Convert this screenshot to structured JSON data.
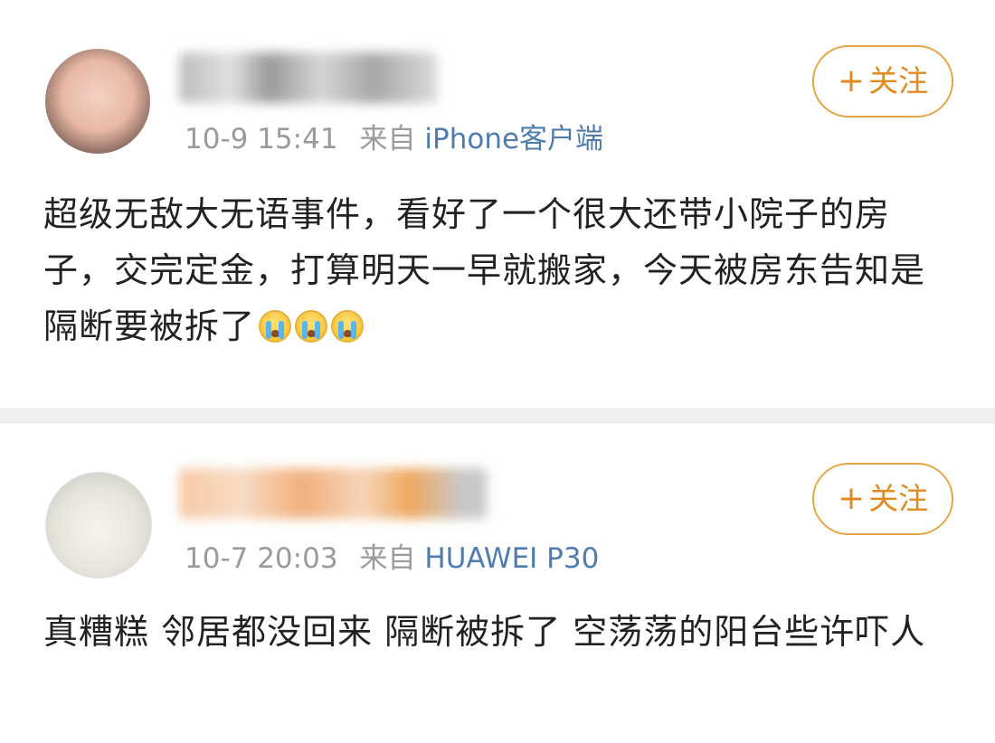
{
  "posts": [
    {
      "meta": {
        "time": "10-9 15:41",
        "from_label": "来自",
        "source": "iPhone客户端"
      },
      "follow": {
        "plus": "+",
        "label": "关注"
      },
      "content": "超级无敌大无语事件，看好了一个很大还带小院子的房子，交完定金，打算明天一早就搬家，今天被房东告知是隔断要被拆了",
      "emoji": [
        "crying-face",
        "crying-face",
        "crying-face"
      ]
    },
    {
      "meta": {
        "time": "10-7 20:03",
        "from_label": "来自",
        "source": "HUAWEI P30"
      },
      "follow": {
        "plus": "+",
        "label": "关注"
      },
      "content": "真糟糕 邻居都没回来 隔断被拆了 空荡荡的阳台些许吓人"
    }
  ],
  "colors": {
    "accent": "#e08a20",
    "source_link": "#4f7cae",
    "meta": "#9a9a9a"
  }
}
